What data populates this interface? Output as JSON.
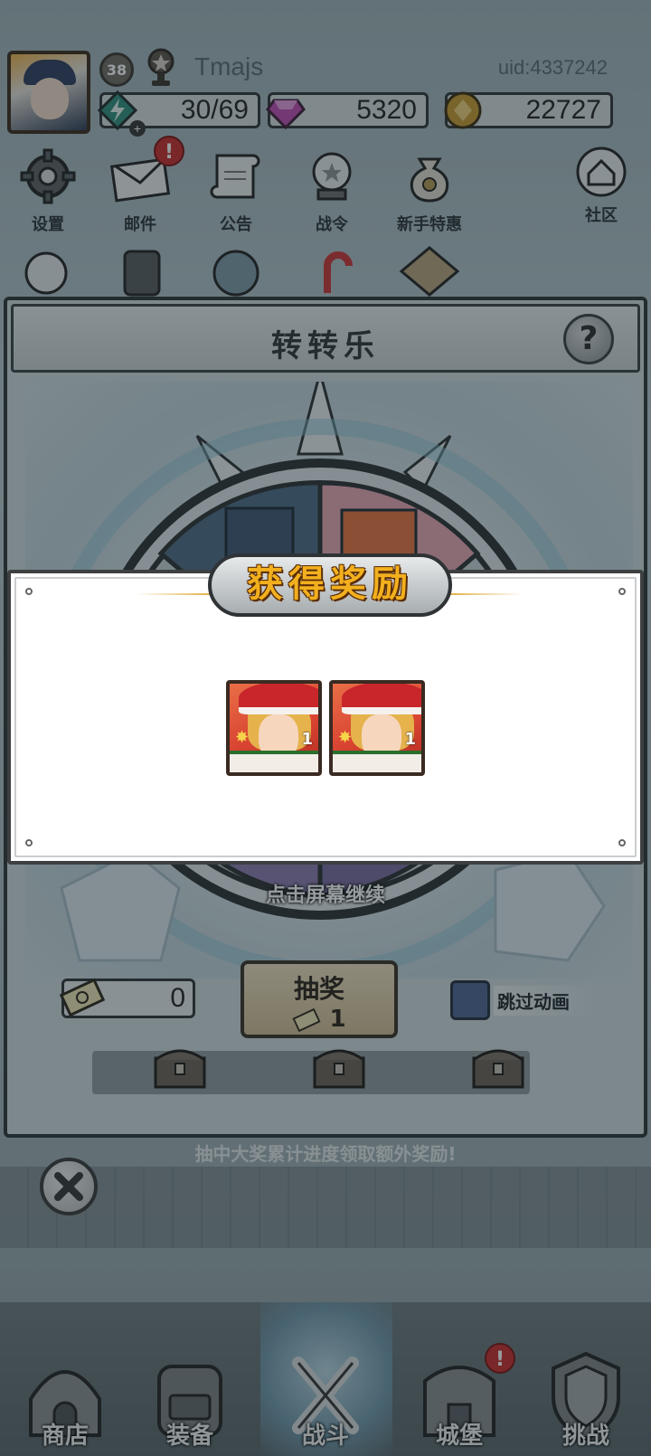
{
  "player": {
    "level": "38",
    "name": "Tmajs",
    "uid": "uid:4337242"
  },
  "currencies": {
    "energy": "30/69",
    "gems": "5320",
    "gold": "22727"
  },
  "menu": {
    "settings": "设置",
    "mail": "邮件",
    "notice": "公告",
    "battle_pass": "战令",
    "newbie_offer": "新手特惠",
    "community": "社区",
    "mail_badge": "!"
  },
  "panel": {
    "title": "转转乐",
    "help": "?",
    "continue_hint": "点击屏幕继续",
    "ticket_count": "0",
    "draw_label": "抽奖",
    "draw_cost": "1",
    "skip_label": "跳过动画",
    "progress_hint": "抽中大奖累计进度领取额外奖励!"
  },
  "reward_modal": {
    "title": "获得奖励",
    "items": [
      {
        "quantity": "1"
      },
      {
        "quantity": "1"
      }
    ]
  },
  "bottom_nav": {
    "shop": "商店",
    "equipment": "装备",
    "battle": "战斗",
    "castle": "城堡",
    "challenge": "挑战",
    "castle_badge": "!"
  }
}
